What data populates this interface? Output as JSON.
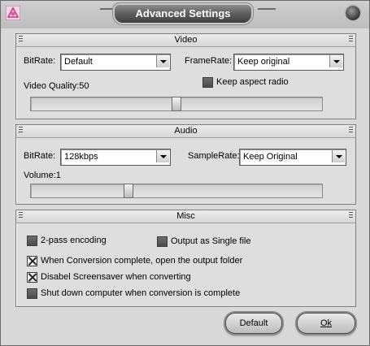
{
  "window": {
    "title": "Advanced Settings"
  },
  "video": {
    "header": "Video",
    "bitrate_label": "BitRate:",
    "bitrate_value": "Default",
    "framerate_label": "FrameRate:",
    "framerate_value": "Keep original",
    "keep_aspect_label": "Keep aspect radio",
    "keep_aspect_checked": false,
    "quality_label": "Video Quality:50",
    "quality_level": 0.5
  },
  "audio": {
    "header": "Audio",
    "bitrate_label": "BitRate:",
    "bitrate_value": "128kbps",
    "samplerate_label": "SampleRate:",
    "samplerate_value": "Keep Original",
    "volume_label": "Volume:1",
    "volume_level": 0.33
  },
  "misc": {
    "header": "Misc",
    "two_pass_label": "2-pass encoding",
    "two_pass_checked": false,
    "single_file_label": "Output as Single file",
    "single_file_checked": false,
    "open_folder_label": "When Conversion complete, open the output folder",
    "open_folder_checked": true,
    "disable_saver_label": "Disabel Screensaver when converting",
    "disable_saver_checked": true,
    "shutdown_label": "Shut down computer when conversion is complete",
    "shutdown_checked": false
  },
  "buttons": {
    "default_label": "Default",
    "ok_label": "Ok"
  }
}
